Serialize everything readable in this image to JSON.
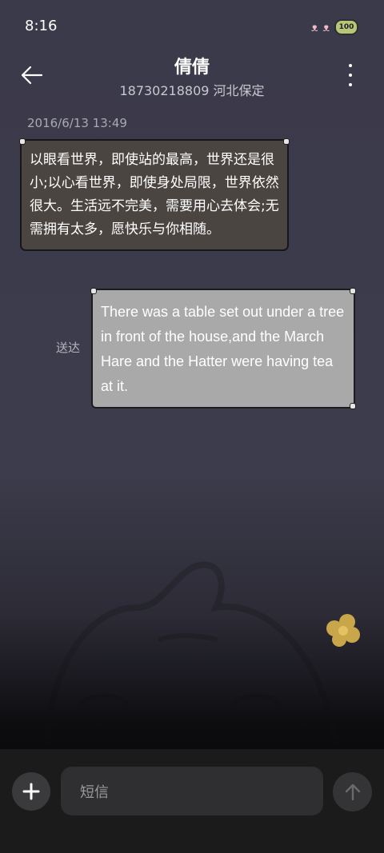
{
  "status_bar": {
    "time": "8:16",
    "battery": "100"
  },
  "header": {
    "title": "倩倩",
    "subtitle": "18730218809 河北保定"
  },
  "conversation": {
    "timestamp": "2016/6/13 13:49",
    "incoming_message": "以眼看世界，即使站的最高，世界还是很小;以心看世界，即使身处局限，世界依然很大。生活远不完美，需要用心去体会;无需拥有太多，愿快乐与你相随。",
    "outgoing_message": "There was a table set out under a tree in front of the house,and the March Hare and the Hatter were having tea at it.",
    "sent_status": "送达"
  },
  "composer": {
    "placeholder": "短信",
    "add_icon": "plus-icon",
    "send_icon": "arrow-up-icon"
  },
  "colors": {
    "background": "#3b3a4a",
    "incoming_bubble": "#4b4542",
    "outgoing_bubble": "#a9a9a9"
  }
}
